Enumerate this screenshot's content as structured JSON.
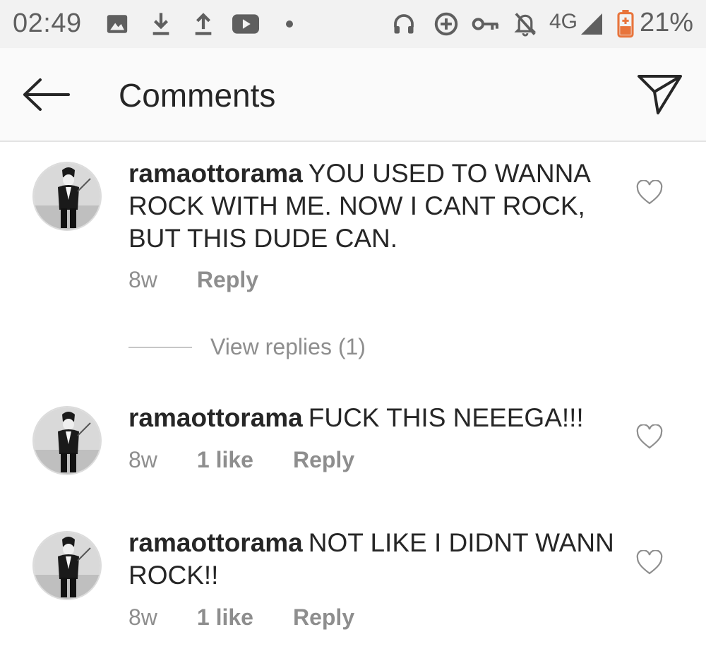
{
  "status_bar": {
    "time": "02:49",
    "network": "4G",
    "battery": "21%",
    "icons": [
      "image-icon",
      "download-icon",
      "upload-icon",
      "youtube-icon",
      "dot-icon",
      "headphones-icon",
      "data-saver-icon",
      "vpn-key-icon",
      "notifications-off-icon",
      "signal-icon",
      "battery-icon"
    ]
  },
  "header": {
    "title": "Comments",
    "back_icon": "arrow-left-icon",
    "share_icon": "send-icon"
  },
  "comments": [
    {
      "username": "ramaottorama",
      "text": "YOU USED TO WANNA ROCK WITH ME. NOW I CANT ROCK, BUT THIS DUDE CAN.",
      "time": "8w",
      "likes": "",
      "reply_label": "Reply"
    },
    {
      "username": "ramaottorama",
      "text": "FUCK THIS NEEEGA!!!",
      "time": "8w",
      "likes": "1 like",
      "reply_label": "Reply"
    },
    {
      "username": "ramaottorama",
      "text": "NOT LIKE I DIDNT WANN ROCK!!",
      "time": "8w",
      "likes": "1 like",
      "reply_label": "Reply"
    }
  ],
  "view_replies": "View replies (1)",
  "colors": {
    "text": "#262626",
    "secondary": "#8e8e8e",
    "statusbar_bg": "#f2f2f2",
    "battery_low": "#e8743b"
  }
}
